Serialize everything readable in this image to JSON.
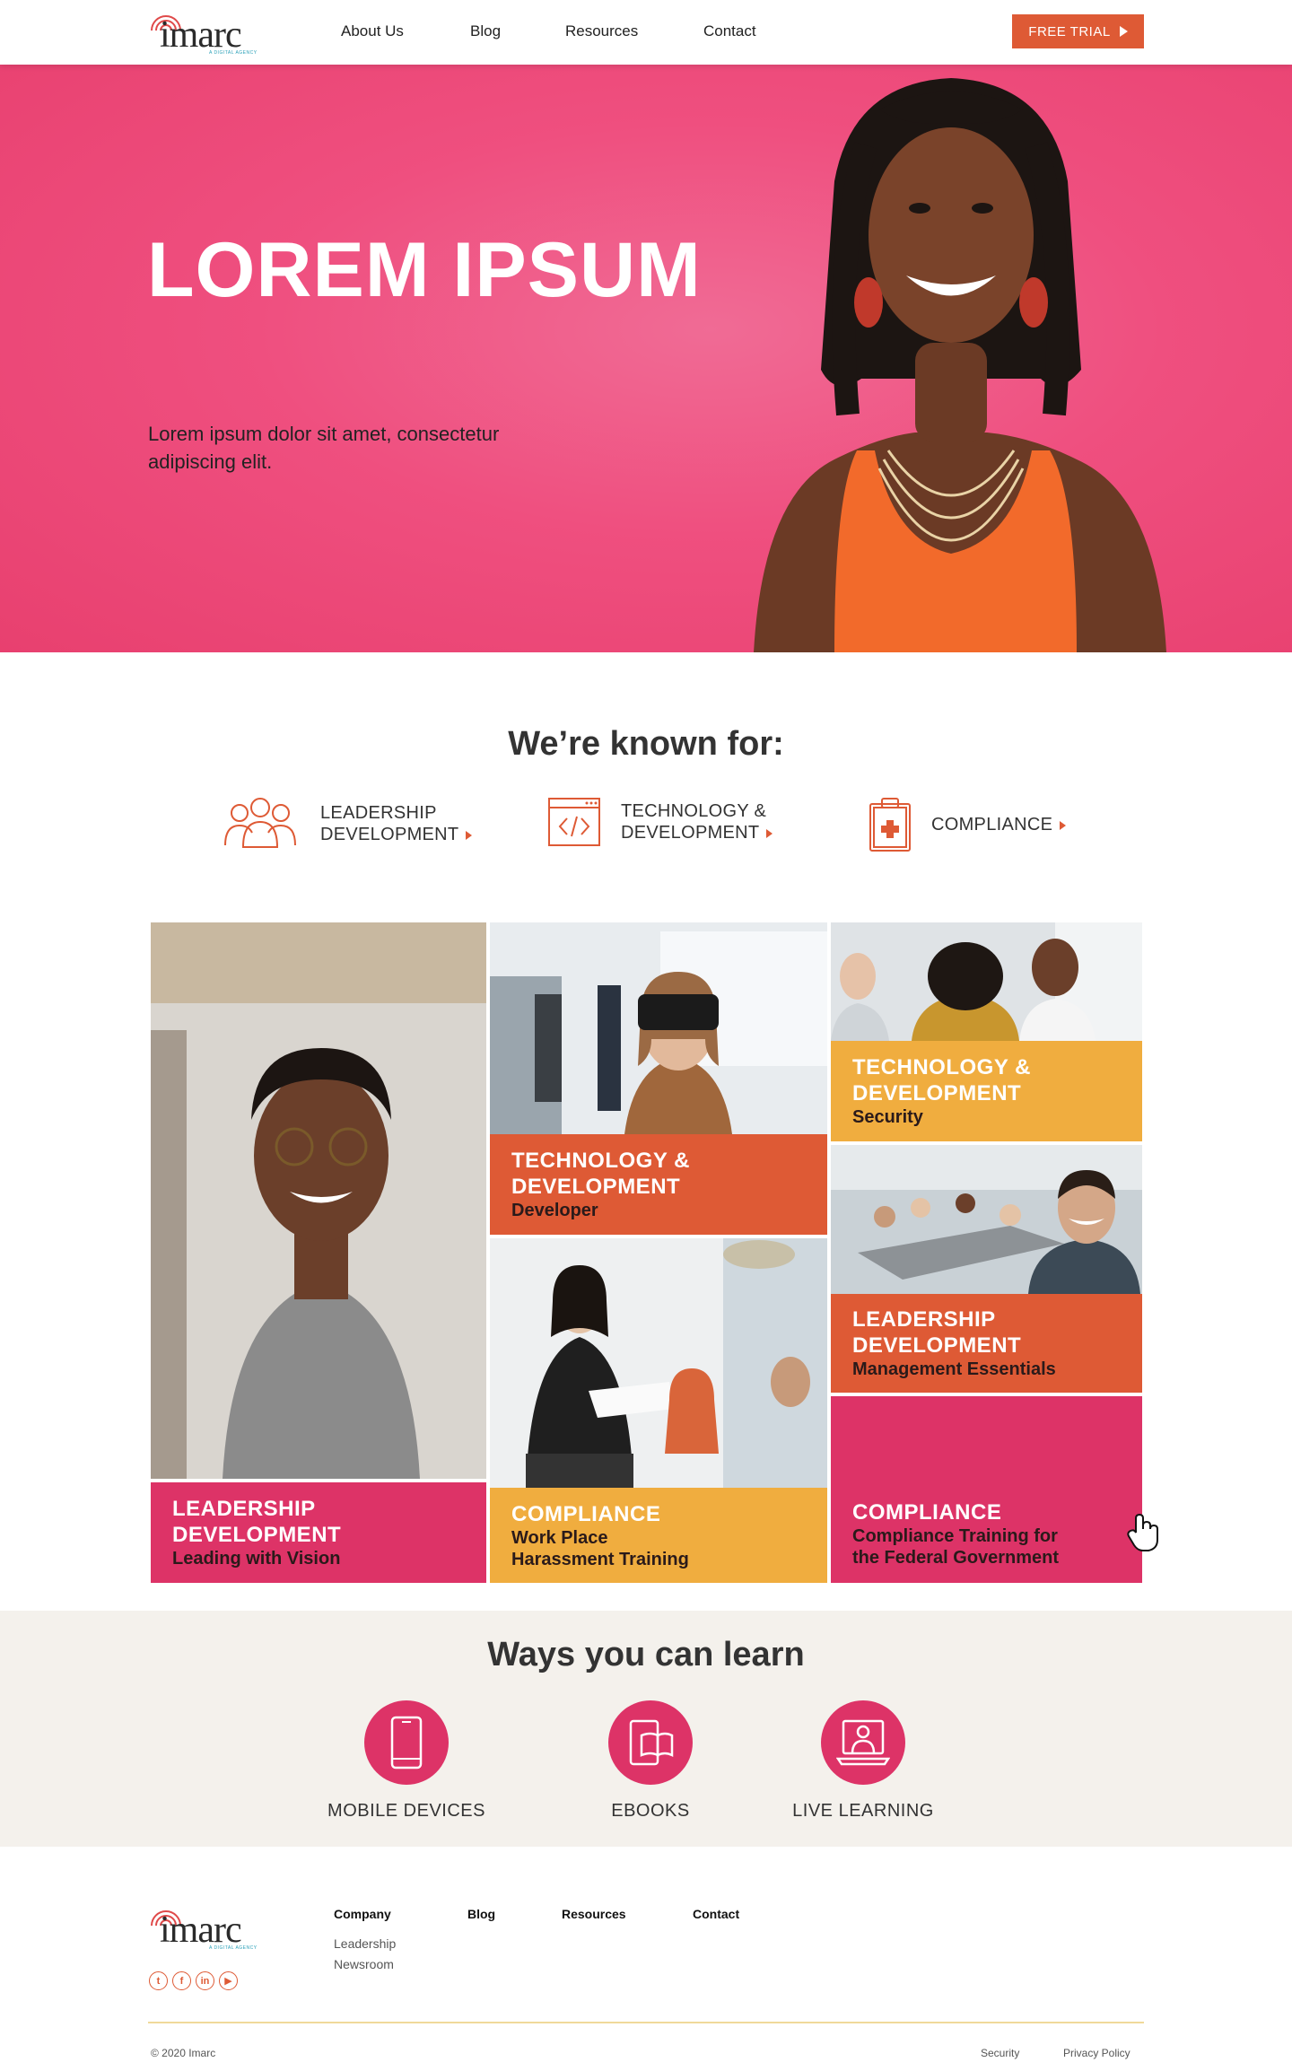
{
  "brand": {
    "name": "imarc",
    "tagline": "A DIGITAL AGENCY",
    "accent": "#de5a35",
    "pink": "#dd3367",
    "yellow": "#f0ad3f"
  },
  "nav": {
    "items": [
      "About Us",
      "Blog",
      "Resources",
      "Contact"
    ],
    "cta_label": "FREE TRIAL"
  },
  "hero": {
    "title": "LOREM IPSUM",
    "subtitle": "Lorem ipsum dolor sit amet, consectetur adipiscing elit."
  },
  "known_for": {
    "title": "We’re known for:",
    "items": [
      {
        "line1": "LEADERSHIP",
        "line2": "DEVELOPMENT",
        "icon": "people-group-icon"
      },
      {
        "line1": "TECHNOLOGY &",
        "line2": "DEVELOPMENT",
        "icon": "code-window-icon"
      },
      {
        "line1": "COMPLIANCE",
        "line2": "",
        "icon": "clipboard-cross-icon"
      }
    ]
  },
  "courses": [
    {
      "category_1": "LEADERSHIP",
      "category_2": "DEVELOPMENT",
      "title_1": "Leading with Vision",
      "title_2": "",
      "color": "#dd3367"
    },
    {
      "category_1": "TECHNOLOGY &",
      "category_2": "DEVELOPMENT",
      "title_1": "Developer",
      "title_2": "",
      "color": "#de5a35"
    },
    {
      "category_1": "COMPLIANCE",
      "category_2": "",
      "title_1": "Work Place",
      "title_2": "Harassment Training",
      "color": "#f0ad3f"
    },
    {
      "category_1": "TECHNOLOGY &",
      "category_2": "DEVELOPMENT",
      "title_1": "Security",
      "title_2": "",
      "color": "#f0ad3f"
    },
    {
      "category_1": "LEADERSHIP",
      "category_2": "DEVELOPMENT",
      "title_1": "Management Essentials",
      "title_2": "",
      "color": "#de5a35"
    },
    {
      "category_1": "COMPLIANCE",
      "category_2": "",
      "title_1": "Compliance Training for",
      "title_2": "the Federal Government",
      "color": "#dd3367"
    }
  ],
  "ways": {
    "title": "Ways you can learn",
    "items": [
      {
        "label": "MOBILE DEVICES",
        "icon": "mobile-phone-icon"
      },
      {
        "label": "EBOOKS",
        "icon": "ebook-icon"
      },
      {
        "label": "LIVE LEARNING",
        "icon": "live-learning-icon"
      }
    ]
  },
  "footer": {
    "columns": [
      "Company",
      "Blog",
      "Resources",
      "Contact"
    ],
    "company_links": [
      "Leadership",
      "Newsroom"
    ],
    "social": [
      "twitter-icon",
      "facebook-icon",
      "linkedin-icon",
      "youtube-icon"
    ],
    "copyright": "© 2020 Imarc",
    "security": "Security",
    "privacy": "Privacy Policy"
  }
}
